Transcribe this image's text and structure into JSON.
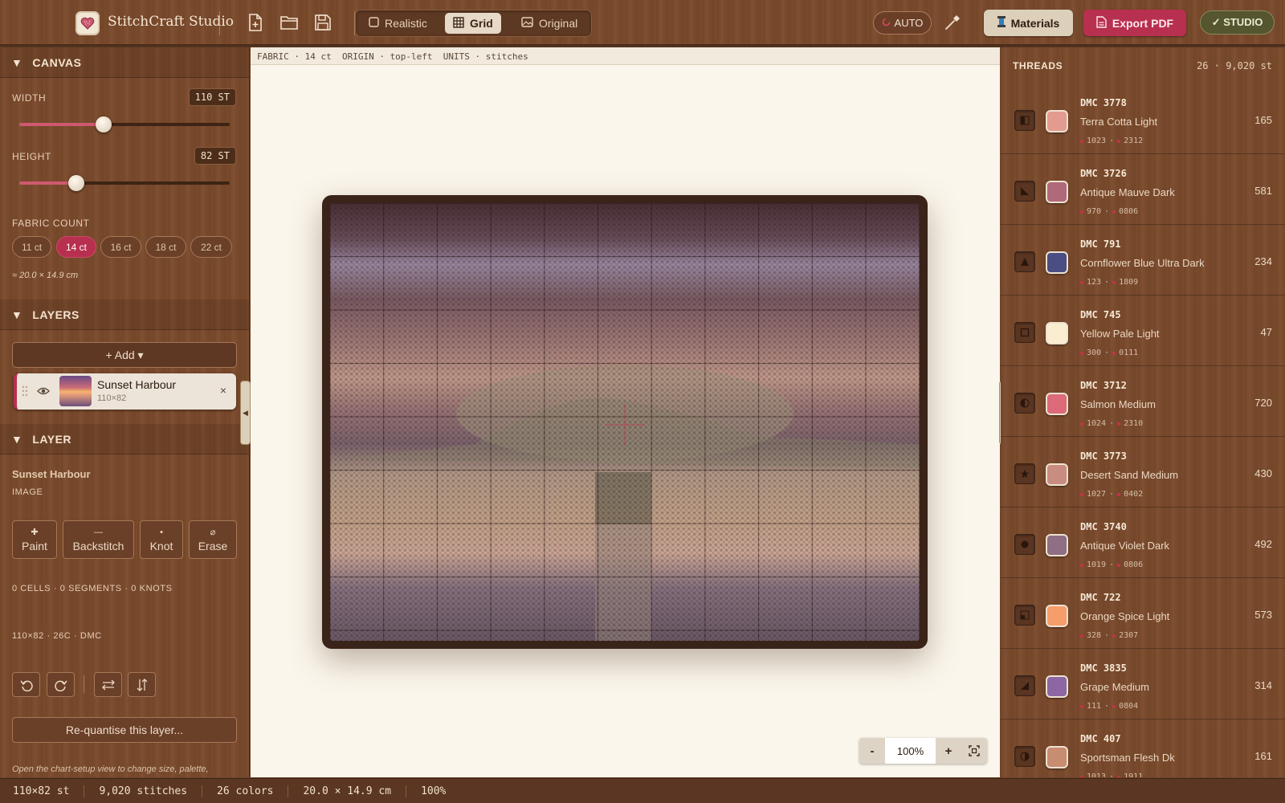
{
  "app": {
    "name": "StitchCraft Studio"
  },
  "toolbar": {
    "view_modes": [
      {
        "label": "Realistic",
        "active": false
      },
      {
        "label": "Grid",
        "active": true
      },
      {
        "label": "Original",
        "active": false
      }
    ],
    "auto_label": "AUTO",
    "materials_label": "Materials",
    "export_label": "Export PDF",
    "studio_label": "✓ STUDIO"
  },
  "canvas_section": {
    "title": "CANVAS",
    "width_label": "WIDTH",
    "width_value": "110 ST",
    "width_fraction": 0.4,
    "height_label": "HEIGHT",
    "height_value": "82 ST",
    "height_fraction": 0.27,
    "fabric_label": "FABRIC COUNT",
    "fabric_options": [
      "11 ct",
      "14 ct",
      "16 ct",
      "18 ct",
      "22 ct"
    ],
    "fabric_selected": "14 ct",
    "size_note": "≈ 20.0 × 14.9 cm"
  },
  "layers_section": {
    "title": "LAYERS",
    "add_label": "+ Add ▾",
    "layers": [
      {
        "name": "Sunset Harbour",
        "dims": "110×82"
      }
    ]
  },
  "layer_section": {
    "title": "LAYER",
    "name": "Sunset Harbour",
    "type": "IMAGE",
    "tools": [
      {
        "glyph": "✚",
        "label": "Paint"
      },
      {
        "glyph": "—",
        "label": "Backstitch"
      },
      {
        "glyph": "•",
        "label": "Knot"
      },
      {
        "glyph": "⌀",
        "label": "Erase"
      }
    ],
    "stats": "0 CELLS · 0 SEGMENTS · 0 KNOTS",
    "summary": "110×82 · 26C · DMC",
    "requantise_label": "Re-quantise this layer...",
    "hint": "Open the chart-setup view to change size, palette,"
  },
  "canvas": {
    "info": "FABRIC · 14 ct  ORIGIN · top-left  UNITS · stitches",
    "zoom": "100%",
    "zoom_out": "-",
    "zoom_in": "+"
  },
  "threads": {
    "title": "THREADS",
    "summary": "26 · 9,020 st",
    "items": [
      {
        "code": "DMC 3778",
        "name": "Terra Cotta Light",
        "alt1": "1023",
        "alt2": "2312",
        "count": "165",
        "color": "#e49b8f",
        "symbol": "half-square"
      },
      {
        "code": "DMC 3726",
        "name": "Antique Mauve Dark",
        "alt1": "970",
        "alt2": "0806",
        "count": "581",
        "color": "#b0697a",
        "symbol": "triangle-corner"
      },
      {
        "code": "DMC 791",
        "name": "Cornflower Blue Ultra Dark",
        "alt1": "123",
        "alt2": "1809",
        "count": "234",
        "color": "#4b4e82",
        "symbol": "triangle"
      },
      {
        "code": "DMC 745",
        "name": "Yellow Pale Light",
        "alt1": "300",
        "alt2": "0111",
        "count": "47",
        "color": "#fbeed0",
        "symbol": "square-outline"
      },
      {
        "code": "DMC 3712",
        "name": "Salmon Medium",
        "alt1": "1024",
        "alt2": "2310",
        "count": "720",
        "color": "#dd6a78",
        "symbol": "half-circle"
      },
      {
        "code": "DMC 3773",
        "name": "Desert Sand Medium",
        "alt1": "1027",
        "alt2": "0402",
        "count": "430",
        "color": "#c98c80",
        "symbol": "star"
      },
      {
        "code": "DMC 3740",
        "name": "Antique Violet Dark",
        "alt1": "1019",
        "alt2": "0806",
        "count": "492",
        "color": "#8f6f83",
        "symbol": "filled-circle"
      },
      {
        "code": "DMC 722",
        "name": "Orange Spice Light",
        "alt1": "328",
        "alt2": "2307",
        "count": "573",
        "color": "#f59d6b",
        "symbol": "quarter-square"
      },
      {
        "code": "DMC 3835",
        "name": "Grape Medium",
        "alt1": "111",
        "alt2": "0804",
        "count": "314",
        "color": "#8c67a3",
        "symbol": "wedge"
      },
      {
        "code": "DMC 407",
        "name": "Sportsman Flesh Dk",
        "alt1": "1013",
        "alt2": "1911",
        "count": "161",
        "color": "#c88c70",
        "symbol": "half-moon"
      }
    ]
  },
  "status": {
    "dims": "110×82 st",
    "stitches": "9,020 stitches",
    "colors": "26 colors",
    "size": "20.0 × 14.9 cm",
    "zoom": "100%"
  },
  "colors": {
    "accent": "#b8304f",
    "studio": "#55552f",
    "wood": "#7a4a2c"
  },
  "icons": [
    "heart-logo-icon",
    "new-file-icon",
    "open-folder-icon",
    "save-icon",
    "eyedropper-icon",
    "spool-icon",
    "pdf-icon",
    "eye-icon",
    "drag-handle-icon",
    "close-icon",
    "undo-icon",
    "redo-icon",
    "flip-horizontal-icon",
    "flip-vertical-icon",
    "fit-screen-icon"
  ]
}
